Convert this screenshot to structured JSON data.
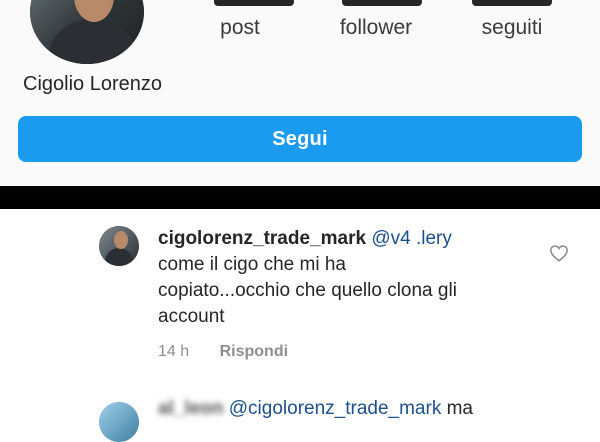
{
  "profile": {
    "stats": [
      {
        "label": "post"
      },
      {
        "label": "follower"
      },
      {
        "label": "seguiti"
      }
    ],
    "name": "Cigolio Lorenzo",
    "follow_label": "Segui"
  },
  "comments": [
    {
      "author": "cigolorenz_trade_mark",
      "mention": "@v4 .lery",
      "text": "come il cigo che mi ha copiato...occhio che quello clona gli account",
      "time": "14 h",
      "reply_label": "Rispondi"
    },
    {
      "author": "al_leon",
      "mention": "@cigolorenz_trade_mark",
      "text": "ma"
    }
  ],
  "icons": {
    "like": "heart-outline-icon"
  }
}
